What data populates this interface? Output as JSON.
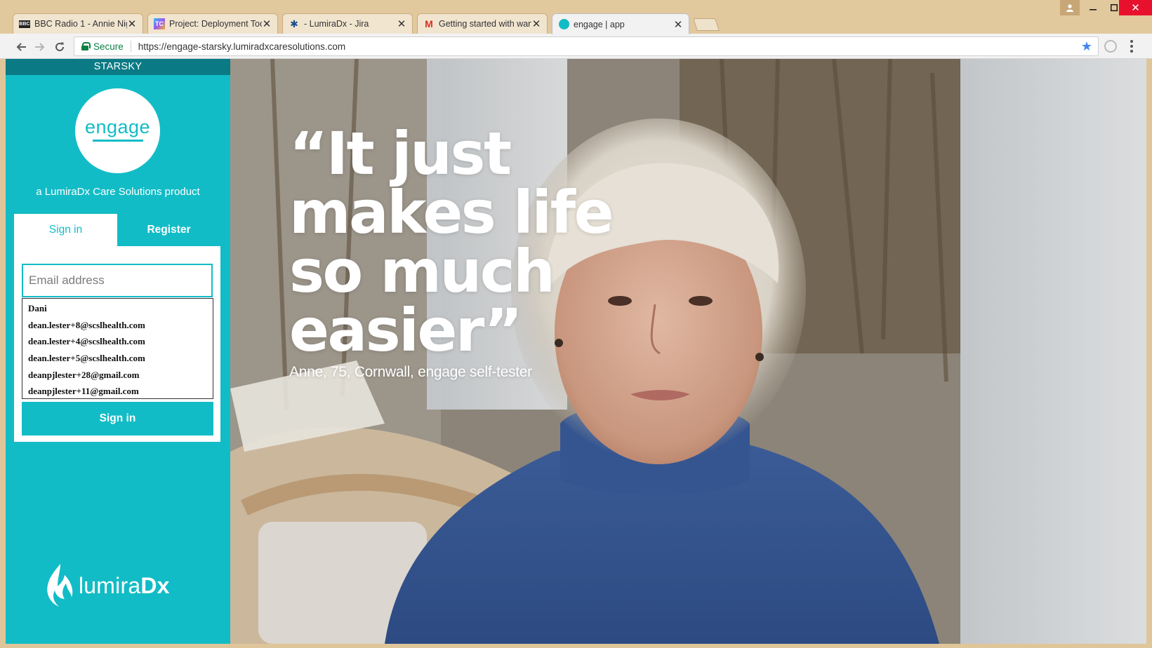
{
  "browser": {
    "tabs": [
      {
        "title": "BBC Radio 1 - Annie Nigh",
        "icon": "bbc-icon"
      },
      {
        "title": "Project: Deployment Tool",
        "icon": "teamcity-icon"
      },
      {
        "title": "- LumiraDx - Jira",
        "icon": "jira-icon"
      },
      {
        "title": "Getting started with warf",
        "icon": "gmail-icon"
      },
      {
        "title": "engage | app",
        "icon": "engage-icon",
        "active": true
      }
    ],
    "address": {
      "secure_label": "Secure",
      "url": "https://engage-starsky.lumiradxcaresolutions.com"
    }
  },
  "sidebar": {
    "environment": "STARSKY",
    "logo_text": "engage",
    "tagline": "a LumiraDx Care Solutions product",
    "tabs": {
      "signin": "Sign in",
      "register": "Register"
    },
    "email_placeholder": "Email address",
    "autofill_options": [
      "Dani",
      "dean.lester+8@scslhealth.com",
      "dean.lester+4@scslhealth.com",
      "dean.lester+5@scslhealth.com",
      "deanpjlester+28@gmail.com",
      "deanpjlester+11@gmail.com"
    ],
    "signin_button": "Sign in",
    "brand": {
      "light": "lumira",
      "bold": "Dx"
    }
  },
  "hero": {
    "quote_lines": [
      "“It just",
      "makes life",
      "so much",
      "easier”"
    ],
    "attribution": "Anne, 75, Cornwall, engage self-tester"
  },
  "colors": {
    "accent": "#12bcc6",
    "environment_bar": "#0a7a85",
    "secure_green": "#0b8043"
  }
}
